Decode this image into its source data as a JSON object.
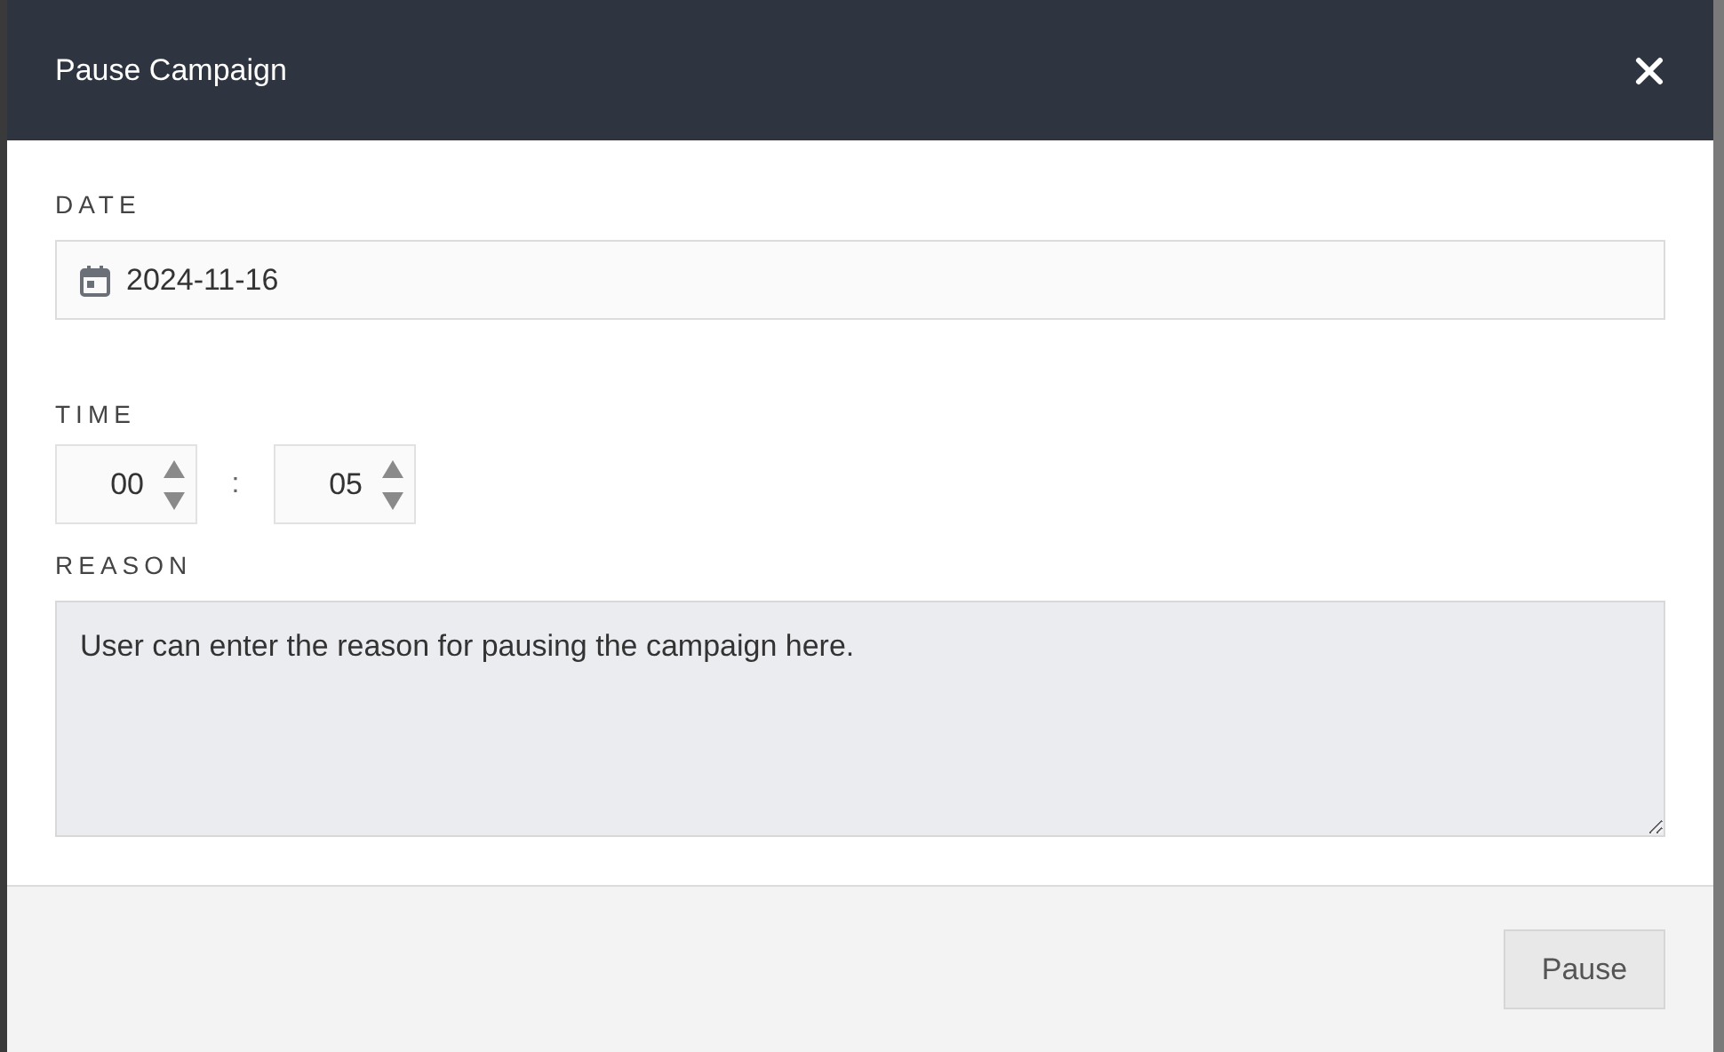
{
  "dialog": {
    "title": "Pause Campaign"
  },
  "date": {
    "label": "DATE",
    "value": "2024-11-16"
  },
  "time": {
    "label": "TIME",
    "hours": "00",
    "separator": ":",
    "minutes": "05"
  },
  "reason": {
    "label": "REASON",
    "value": "User can enter the reason for pausing the campaign here."
  },
  "buttons": [
    {
      "label": "Pause"
    }
  ]
}
